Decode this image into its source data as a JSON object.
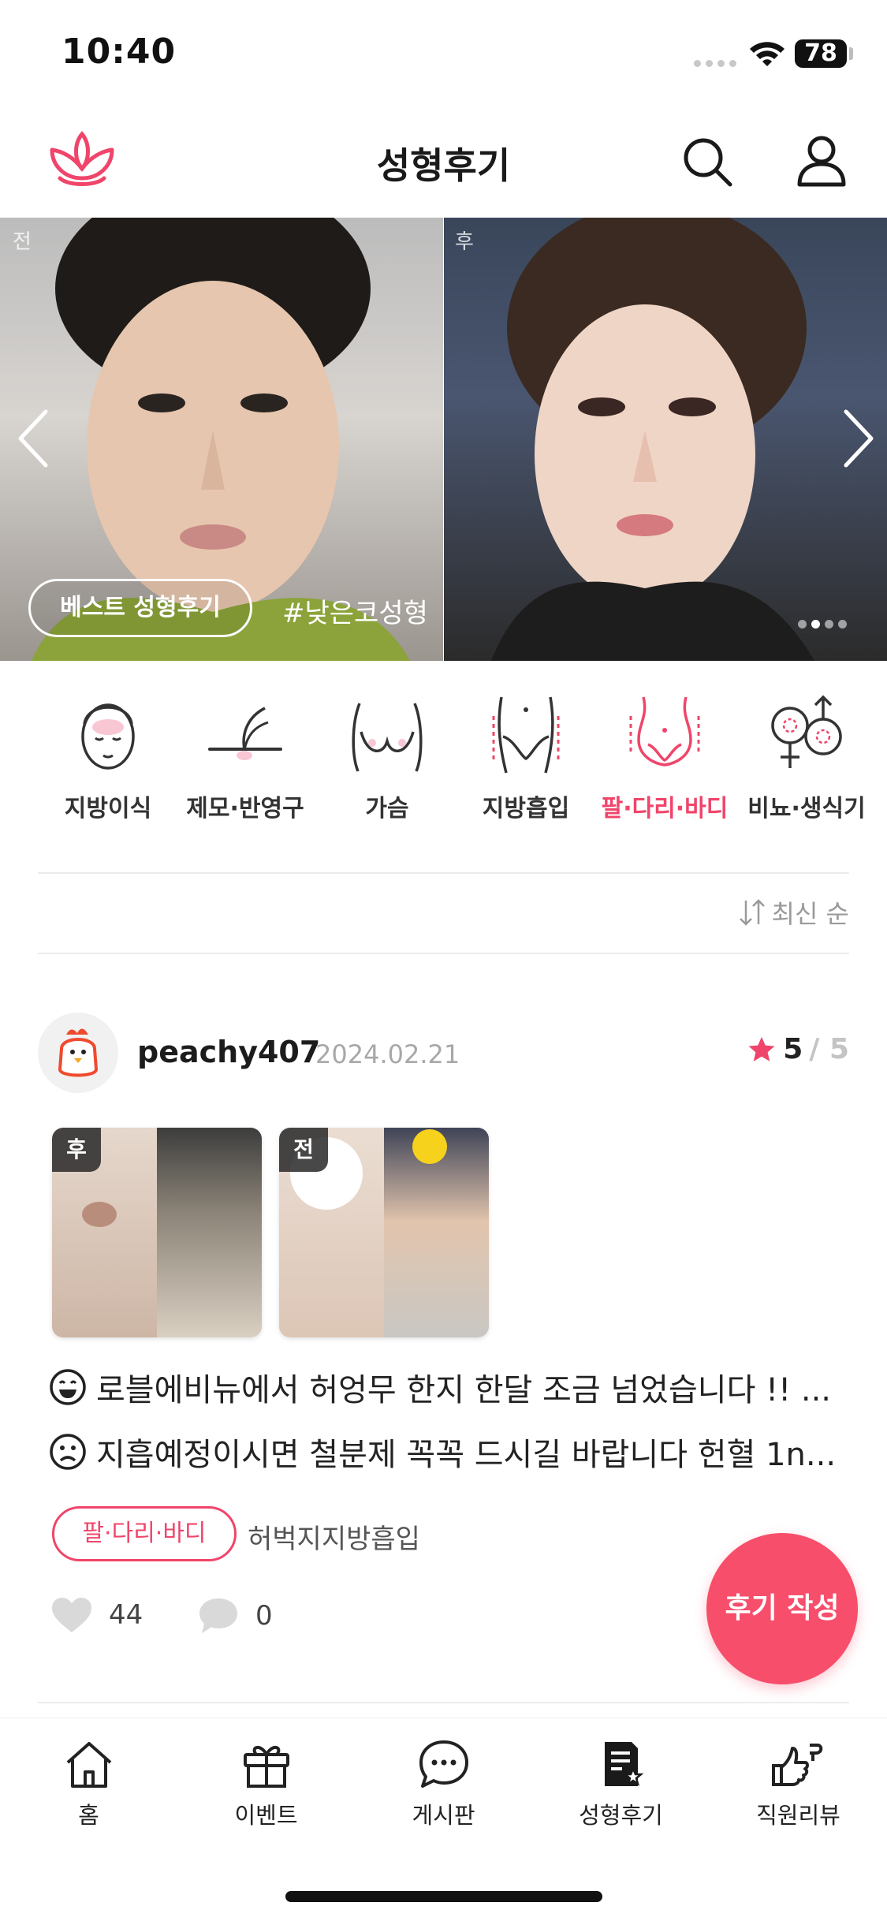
{
  "status_bar": {
    "time": "10:40",
    "battery": "78"
  },
  "header": {
    "title": "성형후기"
  },
  "banner": {
    "before_label": "전",
    "after_label": "후",
    "badge": "베스트 성형후기",
    "hashtag": "#낮은코성형"
  },
  "categories": [
    {
      "label": "지방이식",
      "icon": "face-icon"
    },
    {
      "label": "제모·반영구",
      "icon": "hair-icon"
    },
    {
      "label": "가슴",
      "icon": "chest-icon"
    },
    {
      "label": "지방흡입",
      "icon": "lower-body-icon"
    },
    {
      "label": "팔·다리·바디",
      "icon": "body-icon",
      "active": true
    },
    {
      "label": "비뇨·생식기",
      "icon": "gender-icon"
    }
  ],
  "sort": {
    "label": "최신 순"
  },
  "review": {
    "username": "peachy407",
    "date": "2024.02.21",
    "rating": "5",
    "rating_max": "/ 5",
    "thumbs": [
      {
        "tag": "후"
      },
      {
        "tag": "전"
      }
    ],
    "positive": "로블에비뉴에서 허엉무 한지 한달 조금 넘었습니다 !! ...",
    "negative": "지흡예정이시면 철분제 꼭꼭 드시길 바랍니다 헌혈 1n...",
    "category_tag": "팔·다리·바디",
    "procedure": "허벅지지방흡입",
    "likes": "44",
    "comments": "0"
  },
  "fab": {
    "label": "후기 작성"
  },
  "tabbar": [
    {
      "label": "홈",
      "icon": "home-icon"
    },
    {
      "label": "이벤트",
      "icon": "gift-icon"
    },
    {
      "label": "게시판",
      "icon": "chat-icon"
    },
    {
      "label": "성형후기",
      "icon": "review-doc-icon",
      "active": true
    },
    {
      "label": "직원리뷰",
      "icon": "thumb-icon"
    }
  ],
  "colors": {
    "accent": "#f0456a",
    "fab": "#f74e6b",
    "star": "#f0456a"
  }
}
